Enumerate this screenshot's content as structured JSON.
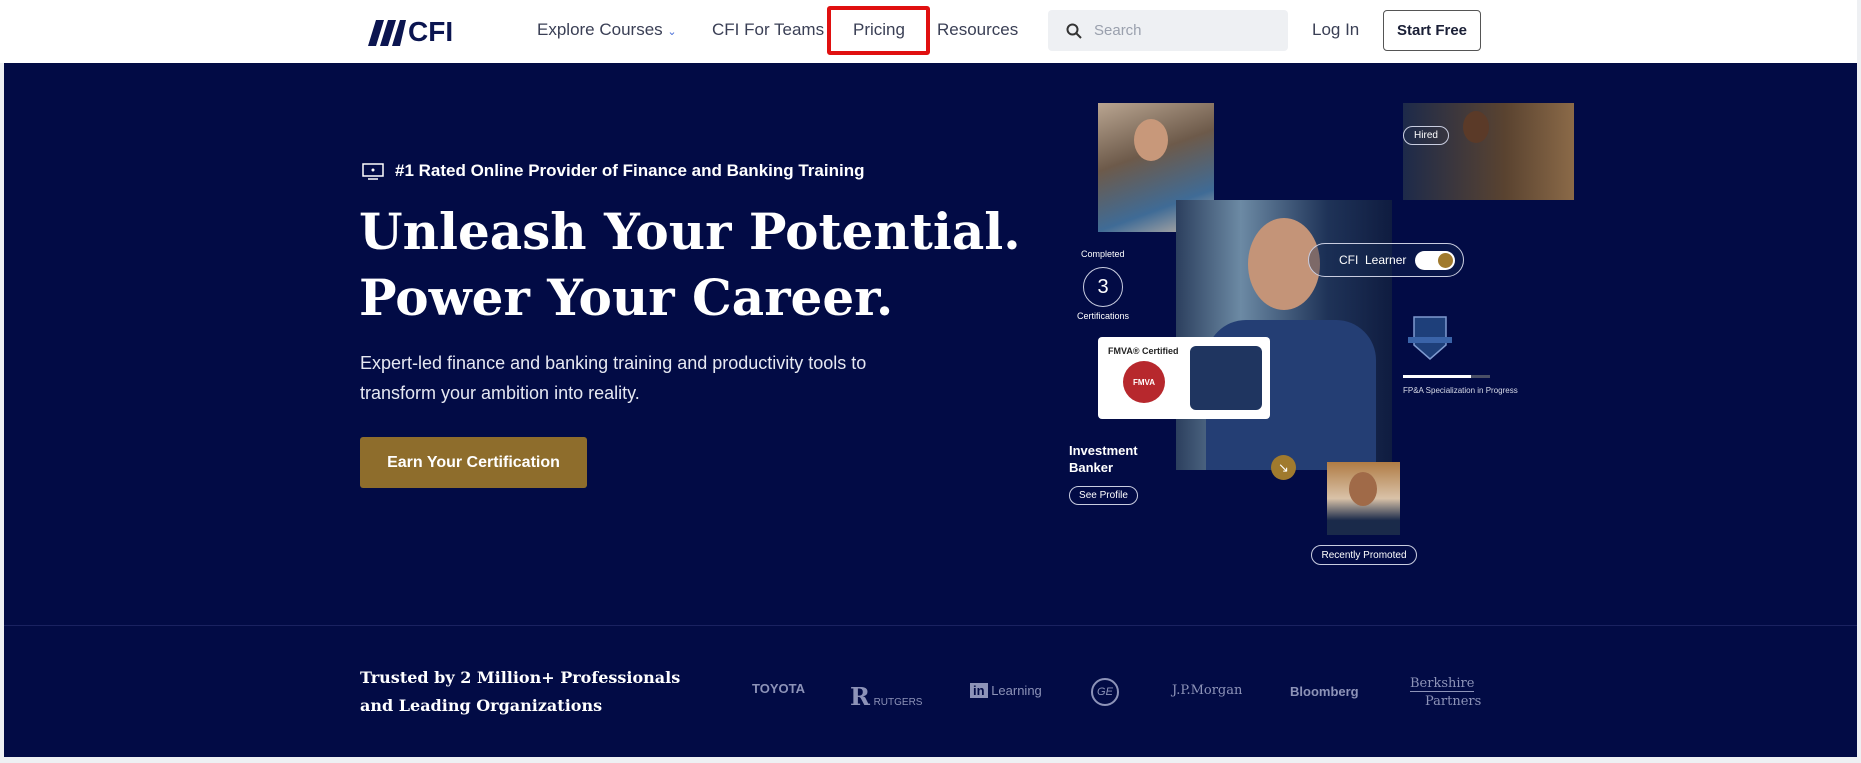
{
  "nav": {
    "logo": "CFI",
    "links": [
      "Explore Courses",
      "CFI For Teams",
      "Pricing",
      "Resources"
    ],
    "search_placeholder": "Search",
    "login": "Log In",
    "start_free": "Start Free"
  },
  "hero": {
    "tagline": "#1 Rated Online Provider of Finance and Banking Training",
    "headline1": "Unleash Your Potential.",
    "headline2": "Power Your Career.",
    "subtitle1": "Expert-led finance and banking training and productivity tools to",
    "subtitle2": "transform your ambition into reality.",
    "cta": "Earn Your Certification"
  },
  "visual": {
    "hired": "Hired",
    "completed": "Completed",
    "cert_count": "3",
    "certifications": "Certifications",
    "cfi_learner": "CFI  Learner",
    "fmva": "FMVA® Certified",
    "fmva_badge": "FMVA",
    "progress_label": "FP&A Specialization in Progress",
    "progress": 0.78,
    "role1": "Investment",
    "role2": "Banker",
    "see_profile": "See Profile",
    "recently_promoted": "Recently Promoted"
  },
  "trusted": {
    "line1": "Trusted by 2 Million+ Professionals",
    "line2": "and Leading Organizations",
    "logos": [
      "TOYOTA",
      "RUTGERS",
      "Learning",
      "GE",
      "J.P.Morgan",
      "Bloomberg",
      "Berkshire",
      "Partners"
    ]
  },
  "colors": {
    "navy": "#020b45",
    "gold": "#8e6d2c",
    "highlight": "#e01010"
  }
}
